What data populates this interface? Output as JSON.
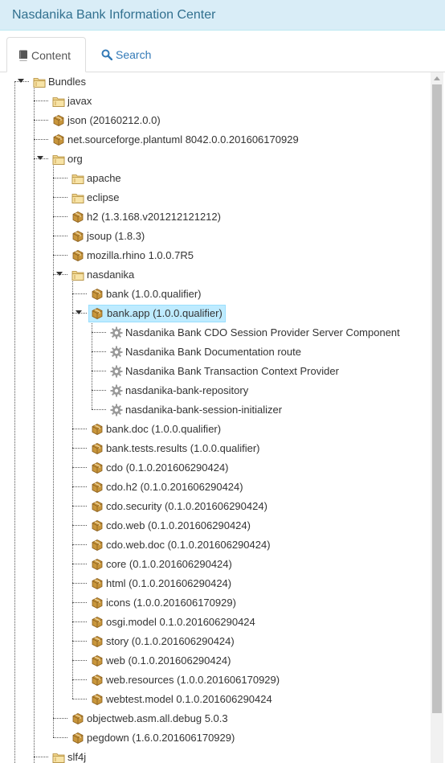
{
  "header": {
    "title": "Nasdanika Bank Information Center"
  },
  "tabs": [
    {
      "label": "Content",
      "icon": "book-icon",
      "active": true
    },
    {
      "label": "Search",
      "icon": "search-icon",
      "active": false
    }
  ],
  "tree": [
    {
      "label": "Bundles",
      "type": "folder",
      "depth": 0,
      "expanded": true
    },
    {
      "label": "javax",
      "type": "folder",
      "depth": 1
    },
    {
      "label": "json (20160212.0.0)",
      "type": "bundle",
      "depth": 1
    },
    {
      "label": "net.sourceforge.plantuml 8042.0.0.201606170929",
      "type": "bundle",
      "depth": 1
    },
    {
      "label": "org",
      "type": "folder",
      "depth": 1,
      "expanded": true
    },
    {
      "label": "apache",
      "type": "folder",
      "depth": 2
    },
    {
      "label": "eclipse",
      "type": "folder",
      "depth": 2
    },
    {
      "label": "h2 (1.3.168.v201212121212)",
      "type": "bundle",
      "depth": 2
    },
    {
      "label": "jsoup (1.8.3)",
      "type": "bundle",
      "depth": 2
    },
    {
      "label": "mozilla.rhino 1.0.0.7R5",
      "type": "bundle",
      "depth": 2
    },
    {
      "label": "nasdanika",
      "type": "folder",
      "depth": 2,
      "expanded": true
    },
    {
      "label": "bank (1.0.0.qualifier)",
      "type": "bundle",
      "depth": 3
    },
    {
      "label": "bank.app (1.0.0.qualifier)",
      "type": "bundle",
      "depth": 3,
      "expanded": true,
      "selected": true
    },
    {
      "label": "Nasdanika Bank CDO Session Provider Server Component",
      "type": "component",
      "depth": 4
    },
    {
      "label": "Nasdanika Bank Documentation route",
      "type": "component",
      "depth": 4
    },
    {
      "label": "Nasdanika Bank Transaction Context Provider",
      "type": "component",
      "depth": 4
    },
    {
      "label": "nasdanika-bank-repository",
      "type": "component",
      "depth": 4
    },
    {
      "label": "nasdanika-bank-session-initializer",
      "type": "component",
      "depth": 4
    },
    {
      "label": "bank.doc (1.0.0.qualifier)",
      "type": "bundle",
      "depth": 3
    },
    {
      "label": "bank.tests.results (1.0.0.qualifier)",
      "type": "bundle",
      "depth": 3
    },
    {
      "label": "cdo (0.1.0.201606290424)",
      "type": "bundle",
      "depth": 3
    },
    {
      "label": "cdo.h2 (0.1.0.201606290424)",
      "type": "bundle",
      "depth": 3
    },
    {
      "label": "cdo.security (0.1.0.201606290424)",
      "type": "bundle",
      "depth": 3
    },
    {
      "label": "cdo.web (0.1.0.201606290424)",
      "type": "bundle",
      "depth": 3
    },
    {
      "label": "cdo.web.doc (0.1.0.201606290424)",
      "type": "bundle",
      "depth": 3
    },
    {
      "label": "core (0.1.0.201606290424)",
      "type": "bundle",
      "depth": 3
    },
    {
      "label": "html (0.1.0.201606290424)",
      "type": "bundle",
      "depth": 3
    },
    {
      "label": "icons (1.0.0.201606170929)",
      "type": "bundle",
      "depth": 3
    },
    {
      "label": "osgi.model 0.1.0.201606290424",
      "type": "bundle",
      "depth": 3
    },
    {
      "label": "story (0.1.0.201606290424)",
      "type": "bundle",
      "depth": 3
    },
    {
      "label": "web (0.1.0.201606290424)",
      "type": "bundle",
      "depth": 3
    },
    {
      "label": "web.resources (1.0.0.201606170929)",
      "type": "bundle",
      "depth": 3
    },
    {
      "label": "webtest.model 0.1.0.201606290424",
      "type": "bundle",
      "depth": 3
    },
    {
      "label": "objectweb.asm.all.debug 5.0.3",
      "type": "bundle",
      "depth": 2
    },
    {
      "label": "pegdown (1.6.0.201606170929)",
      "type": "bundle",
      "depth": 2
    },
    {
      "label": "slf4j",
      "type": "folder",
      "depth": 1
    }
  ],
  "colors": {
    "header_bg": "#d9edf7",
    "header_text": "#31708f",
    "link": "#337ab7",
    "selected_bg": "#beebff",
    "bundle_icon": "#c8963c",
    "folder_icon": "#f0d48a"
  }
}
